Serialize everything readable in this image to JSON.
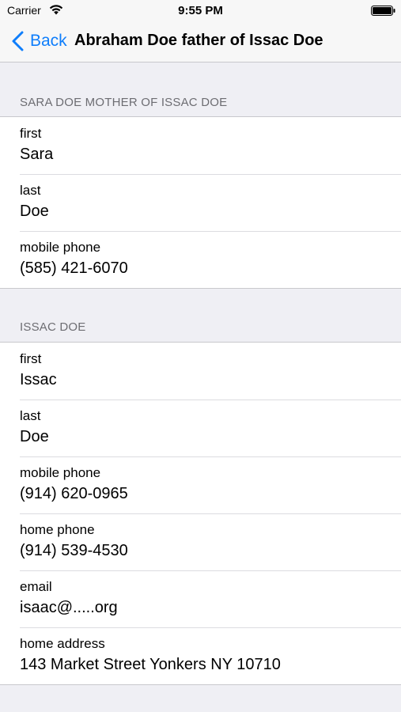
{
  "status_bar": {
    "carrier": "Carrier",
    "time": "9:55 PM",
    "wifi_icon": "wifi-icon",
    "battery_icon": "battery-icon"
  },
  "nav": {
    "back_label": "Back",
    "title": "Abraham Doe father of Issac Doe",
    "accent_color": "#0f7efb"
  },
  "sections": [
    {
      "header": "SARA DOE MOTHER OF ISSAC DOE",
      "rows": [
        {
          "label": "first",
          "value": "Sara"
        },
        {
          "label": "last",
          "value": "Doe"
        },
        {
          "label": "mobile phone",
          "value": "(585) 421-6070"
        }
      ]
    },
    {
      "header": "ISSAC DOE",
      "rows": [
        {
          "label": "first",
          "value": "Issac"
        },
        {
          "label": "last",
          "value": "Doe"
        },
        {
          "label": "mobile phone",
          "value": "(914) 620-0965"
        },
        {
          "label": "home phone",
          "value": "(914) 539-4530"
        },
        {
          "label": "email",
          "value": "isaac@.....org"
        },
        {
          "label": "home address",
          "value": "143 Market Street Yonkers NY 10710"
        }
      ]
    }
  ]
}
